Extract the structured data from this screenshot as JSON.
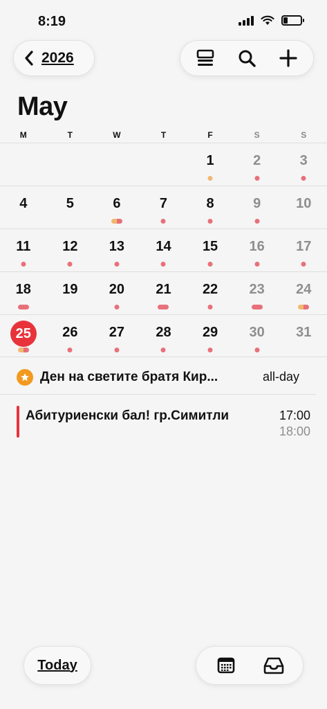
{
  "status_bar": {
    "time": "8:19",
    "battery_level": 0.25
  },
  "header": {
    "back_label": "2026"
  },
  "month": {
    "title": "May"
  },
  "weekdays": [
    {
      "label": "M",
      "weekend": false
    },
    {
      "label": "T",
      "weekend": false
    },
    {
      "label": "W",
      "weekend": false
    },
    {
      "label": "T",
      "weekend": false
    },
    {
      "label": "F",
      "weekend": false
    },
    {
      "label": "S",
      "weekend": true
    },
    {
      "label": "S",
      "weekend": true
    }
  ],
  "weeks": [
    [
      {
        "day": ""
      },
      {
        "day": ""
      },
      {
        "day": ""
      },
      {
        "day": ""
      },
      {
        "day": "1",
        "marks": [
          "orange-dot"
        ]
      },
      {
        "day": "2",
        "weekend": true,
        "marks": [
          "dot"
        ]
      },
      {
        "day": "3",
        "weekend": true,
        "marks": [
          "dot"
        ]
      }
    ],
    [
      {
        "day": "4"
      },
      {
        "day": "5"
      },
      {
        "day": "6",
        "marks": [
          "split-bar"
        ]
      },
      {
        "day": "7",
        "marks": [
          "dot"
        ]
      },
      {
        "day": "8",
        "marks": [
          "dot"
        ]
      },
      {
        "day": "9",
        "weekend": true,
        "marks": [
          "dot"
        ]
      },
      {
        "day": "10",
        "weekend": true
      }
    ],
    [
      {
        "day": "11",
        "marks": [
          "dot"
        ]
      },
      {
        "day": "12",
        "marks": [
          "dot"
        ]
      },
      {
        "day": "13",
        "marks": [
          "dot"
        ]
      },
      {
        "day": "14",
        "marks": [
          "dot"
        ]
      },
      {
        "day": "15",
        "marks": [
          "dot"
        ]
      },
      {
        "day": "16",
        "weekend": true,
        "marks": [
          "dot"
        ]
      },
      {
        "day": "17",
        "weekend": true,
        "marks": [
          "dot"
        ]
      }
    ],
    [
      {
        "day": "18",
        "marks": [
          "pink-bar"
        ]
      },
      {
        "day": "19"
      },
      {
        "day": "20",
        "marks": [
          "dot"
        ]
      },
      {
        "day": "21",
        "marks": [
          "pink-bar"
        ]
      },
      {
        "day": "22",
        "marks": [
          "dot"
        ]
      },
      {
        "day": "23",
        "weekend": true,
        "marks": [
          "pink-bar"
        ]
      },
      {
        "day": "24",
        "weekend": true,
        "marks": [
          "split-bar"
        ]
      }
    ],
    [
      {
        "day": "25",
        "today": true,
        "marks": [
          "split-bar"
        ]
      },
      {
        "day": "26",
        "marks": [
          "dot"
        ]
      },
      {
        "day": "27",
        "marks": [
          "dot"
        ]
      },
      {
        "day": "28",
        "marks": [
          "dot"
        ]
      },
      {
        "day": "29",
        "marks": [
          "dot"
        ]
      },
      {
        "day": "30",
        "weekend": true,
        "marks": [
          "dot"
        ]
      },
      {
        "day": "31",
        "weekend": true
      }
    ]
  ],
  "events": {
    "allday": {
      "title": "Ден на светите братя Кир...",
      "label": "all-day"
    },
    "timed": {
      "title": "Абитуриенски бал! гр.Симитли",
      "start": "17:00",
      "end": "18:00"
    }
  },
  "bottom": {
    "today_label": "Today"
  },
  "colors": {
    "accent_red": "#e8333b",
    "event_pink": "#e8707a",
    "event_orange": "#f1b870",
    "holiday_badge": "#f29a1f"
  },
  "icons": {
    "back": "chevron-left-icon",
    "list": "list-view-icon",
    "search": "search-icon",
    "add": "plus-icon",
    "calendar": "calendar-grid-icon",
    "inbox": "inbox-icon",
    "holiday": "star-icon"
  }
}
